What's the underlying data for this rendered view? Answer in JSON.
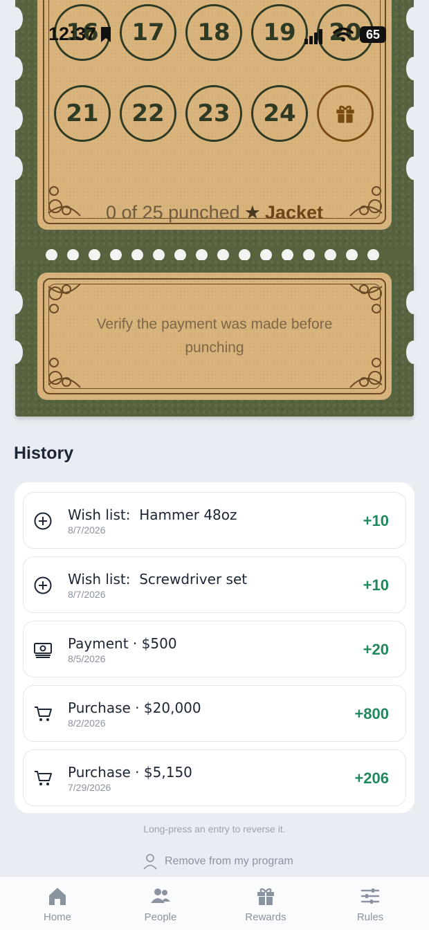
{
  "status_bar": {
    "time": "12:37",
    "battery": "65"
  },
  "punch_card": {
    "numbers_row1": [
      "16",
      "17",
      "18",
      "19",
      "20"
    ],
    "numbers_row2": [
      "21",
      "22",
      "23",
      "24"
    ],
    "progress": "0 of 25 punched",
    "reward": "Jacket",
    "punched_count": 0,
    "total_punches": 25,
    "verify_note": "Verify the payment was made before punching"
  },
  "history": {
    "title": "History",
    "entries": [
      {
        "icon": "plus-circle-icon",
        "label": "Wish list:",
        "detail": "Hammer 48oz",
        "date": "8/7/2026",
        "points": "+10"
      },
      {
        "icon": "plus-circle-icon",
        "label": "Wish list:",
        "detail": "Screwdriver set",
        "date": "8/7/2026",
        "points": "+10"
      },
      {
        "icon": "cash-icon",
        "label": "Payment",
        "detail": "$500",
        "date": "8/5/2026",
        "points": "+20"
      },
      {
        "icon": "cart-icon",
        "label": "Purchase",
        "detail": "$20,000",
        "date": "8/2/2026",
        "points": "+800"
      },
      {
        "icon": "cart-icon",
        "label": "Purchase",
        "detail": "$5,150",
        "date": "7/29/2026",
        "points": "+206"
      }
    ],
    "hint": "Long-press an entry to reverse it.",
    "remove_label": "Remove from my program"
  },
  "tabs": [
    {
      "label": "Home",
      "icon": "home-icon"
    },
    {
      "label": "People",
      "icon": "people-icon"
    },
    {
      "label": "Rewards",
      "icon": "gift-icon"
    },
    {
      "label": "Rules",
      "icon": "sliders-icon"
    }
  ],
  "colors": {
    "ticket_green": "#57633f",
    "paper": "#d9b47c",
    "points_green": "#1e8a5c",
    "background": "#e9ecf2"
  }
}
